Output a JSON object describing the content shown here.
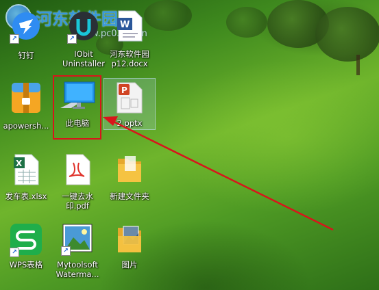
{
  "watermark": {
    "site_name": "河东软件园",
    "url": "www.pc0359.cn"
  },
  "icons": [
    {
      "label": "钉钉",
      "icon": "dingtalk-icon"
    },
    {
      "label": "IObit Uninstaller",
      "icon": "iobit-uninstaller-icon"
    },
    {
      "label": "河东软件园 p12.docx",
      "icon": "word-doc-icon"
    },
    {
      "label": "apowersh...",
      "icon": "archive-icon"
    },
    {
      "label": "此电脑",
      "icon": "this-pc-icon"
    },
    {
      "label": "2.pptx",
      "icon": "pptx-icon"
    },
    {
      "label": "发车表.xlsx",
      "icon": "excel-icon"
    },
    {
      "label": "一键去水印.pdf",
      "icon": "pdf-icon"
    },
    {
      "label": "新建文件夹",
      "icon": "folder-icon"
    },
    {
      "label": "WPS表格",
      "icon": "wps-spreadsheet-icon"
    },
    {
      "label": "Mytoolsoft Waterma...",
      "icon": "mytoolsoft-icon"
    },
    {
      "label": "图片",
      "icon": "pictures-folder-icon"
    }
  ],
  "annotation": {
    "highlight_color": "#d8151b",
    "arrow_color": "#d8151b"
  },
  "colors": {
    "wps_green": "#1fae4b",
    "ppt_red": "#d04423",
    "excel_green": "#1e7145",
    "word_blue": "#2b579a",
    "folder_yellow": "#f5c342"
  }
}
